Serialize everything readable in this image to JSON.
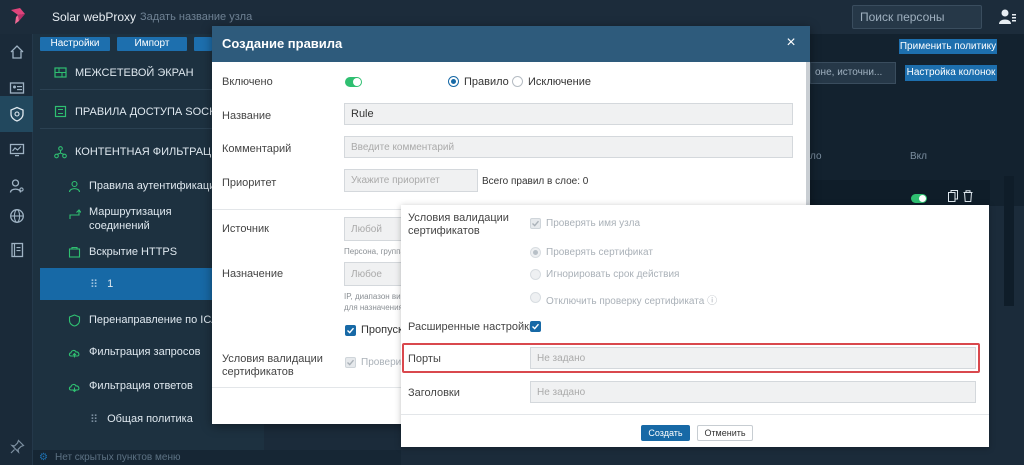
{
  "app": {
    "title": "Solar webProxy",
    "project_placeholder": "Задать название узла"
  },
  "header": {
    "person_search_placeholder": "Поиск персоны"
  },
  "rail": {
    "icons": [
      "home-icon",
      "id-card-icon",
      "shield-icon",
      "monitor-chart-icon",
      "user-key-icon",
      "globe-icon",
      "book-icon",
      "pin-icon"
    ]
  },
  "nav": {
    "buttons": {
      "settings": "Настройки",
      "import": "Импорт"
    },
    "items": {
      "firewall": "Межсетевой экран",
      "socks": "Правила доступа SOCKS5",
      "content": "Контентная фильтрация",
      "auth": "Правила аутентификации",
      "routing": "Маршрутизация соединений",
      "https": "Вскрытие HTTPS",
      "layer": "1",
      "icap": "Перенаправление по ICAP",
      "req": "Фильтрация запросов",
      "resp": "Фильтрация ответов",
      "general": "Общая политика"
    },
    "hidden_items": "Нет скрытых пунктов меню"
  },
  "background": {
    "apply_policy": "Применить политику",
    "search_text": "оне, источни...",
    "columns_button": "Настройка колонок",
    "col_header_1": "ло",
    "col_header_2": "Вкл"
  },
  "modal": {
    "title": "Создание правила",
    "close": "×",
    "enabled_label": "Включено",
    "enabled": true,
    "rule_type": {
      "rule": "Правило",
      "exception": "Исключение",
      "selected": "rule"
    },
    "name_label": "Название",
    "name_value": "Rule",
    "comment_label": "Комментарий",
    "comment_placeholder": "Введите комментарий",
    "priority_label": "Приоритет",
    "priority_placeholder": "Укажите приоритет",
    "total_rules": "Всего правил в слое: 0",
    "source_label": "Источник",
    "source_placeholder": "Любой",
    "source_hint": "Персона, группа",
    "dest_label": "Назначение",
    "dest_placeholder": "Любое",
    "dest_hint_1": "IP, диапазон ви",
    "dest_hint_2": "для назначения",
    "pass_label": "Пропуска",
    "cert_label_1": "Условия валидации",
    "cert_label_2": "сертификатов",
    "check_host_trunc": "Провери"
  },
  "panel": {
    "cert_label_1": "Условия валидации",
    "cert_label_2": "сертификатов",
    "check_host": "Проверять имя узла",
    "check_cert": "Проверять сертификат",
    "ignore_expiry": "Игнорировать срок действия",
    "disable_check": "Отключить проверку сертификата ⓘ",
    "advanced_label": "Расширенные настройки",
    "ports_label": "Порты",
    "ports_value": "Не задано",
    "headers_label": "Заголовки",
    "headers_value": "Не задано",
    "create_button": "Создать",
    "cancel_button": "Отменить"
  }
}
